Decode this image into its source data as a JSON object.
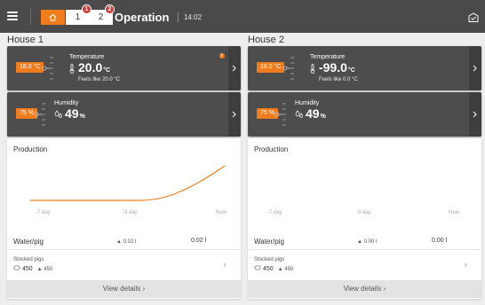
{
  "topbar": {
    "menu_icon": "hamburger-icon",
    "home_icon": "home-icon",
    "tabs": [
      {
        "label": "1",
        "badge": "1"
      },
      {
        "label": "2",
        "badge": "2"
      }
    ],
    "title": "Operation",
    "time": "14:02",
    "right_icon": "report-check-icon"
  },
  "colors": {
    "accent": "#f07c1b",
    "topbar": "#4a4a4a",
    "sensor_card": "#4d4d4d",
    "badge": "#d03a3a"
  },
  "houses": [
    {
      "title": "House 1",
      "temperature": {
        "label": "Temperature",
        "setpoint": "18.0 °C",
        "value": "20.0",
        "unit": "°C",
        "feels_like": "Feels like 20.0 °C",
        "warning": "!"
      },
      "humidity": {
        "label": "Humidity",
        "setpoint": "75 %",
        "value": "49",
        "unit": "%"
      },
      "production": {
        "title": "Production",
        "x_ticks": [
          "-7 day",
          "-3 day",
          "Now"
        ],
        "water_label": "Water/pig",
        "water_delta": "▲ 0.02 l",
        "water_value": "0.02 l",
        "stocked_label": "Stocked pigs",
        "stocked_value": "450",
        "stocked_delta": "▲ 450",
        "details": "View details",
        "details_chevron": "›"
      }
    },
    {
      "title": "House 2",
      "temperature": {
        "label": "Temperature",
        "setpoint": "18.0 °C",
        "value": "-99.0",
        "unit": "°C",
        "feels_like": "Feels like 0.0 °C"
      },
      "humidity": {
        "label": "Humidity",
        "setpoint": "75 %",
        "value": "49",
        "unit": "%"
      },
      "production": {
        "title": "Production",
        "x_ticks": [
          "-7 day",
          "-3 day",
          "Now"
        ],
        "water_label": "Water/pig",
        "water_delta": "▲ 0.00 l",
        "water_value": "0.00 l",
        "stocked_label": "Stocked pigs",
        "stocked_value": "450",
        "stocked_delta": "▲ 450",
        "details": "View details",
        "details_chevron": "›"
      }
    }
  ]
}
